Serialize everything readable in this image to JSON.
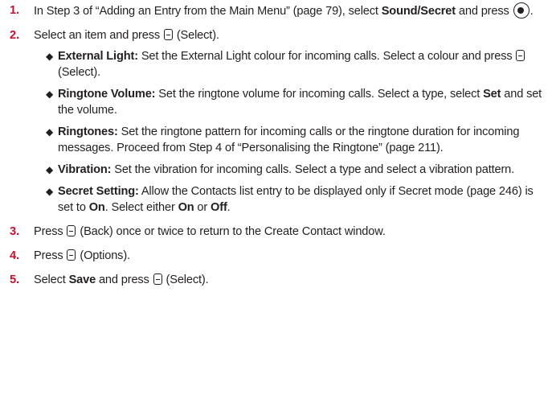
{
  "step1": {
    "num": "1.",
    "text_a": "In Step 3 of “Adding an Entry from the Main Menu” (page 79), select ",
    "bold": "Sound/Secret",
    "text_b": " and press ",
    "text_c": "."
  },
  "step2": {
    "num": "2.",
    "text_a": "Select an item and press ",
    "text_b": " (Select).",
    "items": [
      {
        "term": "External Light:",
        "text_a": " Set the External Light colour for incoming calls. Select a colour and press ",
        "text_b": " (Select)."
      },
      {
        "term": "Ringtone Volume:",
        "text_a": " Set the ringtone volume for incoming calls. Select a type, select ",
        "bold": "Set",
        "text_b": " and set the volume."
      },
      {
        "term": "Ringtones:",
        "text": " Set the ringtone pattern for incoming calls or the ringtone duration for incoming messages. Proceed from Step 4 of “Personalising the Ringtone” (page 211)."
      },
      {
        "term": "Vibration:",
        "text": " Set the vibration for incoming calls. Select a type and select a vibration pattern."
      },
      {
        "term": "Secret Setting:",
        "text_a": " Allow the Contacts list entry to be displayed only if Secret mode (page 246) is set to ",
        "bold_a": "On",
        "text_b": ". Select either ",
        "bold_b": "On",
        "text_c": " or ",
        "bold_c": "Off",
        "text_d": "."
      }
    ]
  },
  "step3": {
    "num": "3.",
    "text_a": "Press ",
    "text_b": " (Back) once or twice to return to the Create Contact window."
  },
  "step4": {
    "num": "4.",
    "text_a": "Press ",
    "text_b": " (Options)."
  },
  "step5": {
    "num": "5.",
    "text_a": "Select ",
    "bold": "Save",
    "text_b": " and press ",
    "text_c": " (Select)."
  },
  "icons": {
    "center_key": "center-select-key-icon",
    "left_soft_key": "left-soft-key-icon",
    "right_soft_key": "right-soft-key-icon"
  },
  "colors": {
    "step_number": "#c8102e",
    "text": "#231f20"
  }
}
